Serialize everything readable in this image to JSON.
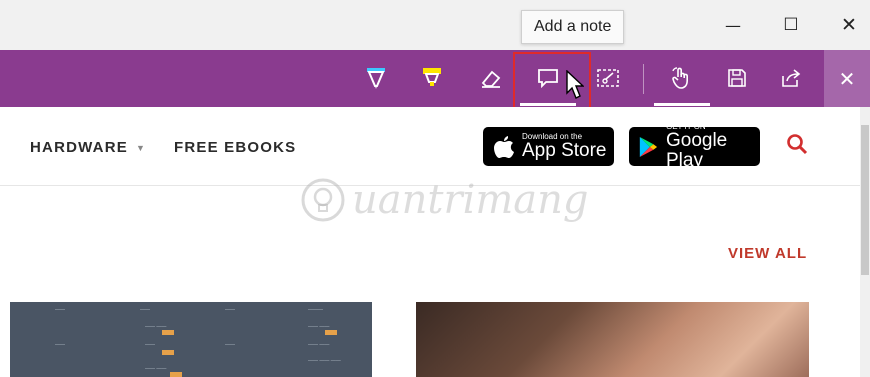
{
  "window": {
    "tooltip": "Add a note",
    "minimize_glyph": "—",
    "maximize_glyph": "☐",
    "close_glyph": "✕"
  },
  "ink_toolbar": {
    "tools": [
      {
        "name": "ballpoint-pen",
        "icon": "pen-icon",
        "color": "#3cc8ff"
      },
      {
        "name": "highlighter",
        "icon": "highlighter-icon",
        "color": "#ffe600"
      },
      {
        "name": "eraser",
        "icon": "eraser-icon"
      },
      {
        "name": "add-a-note",
        "icon": "note-icon",
        "active": true
      },
      {
        "name": "clip",
        "icon": "clip-icon"
      },
      {
        "name": "touch-writing",
        "icon": "touch-icon",
        "active": true
      },
      {
        "name": "save-web-note",
        "icon": "save-icon"
      },
      {
        "name": "share-web-note",
        "icon": "share-icon"
      },
      {
        "name": "exit",
        "icon": "close-icon"
      }
    ],
    "exit_glyph": "✕",
    "background": "#8a3b8f"
  },
  "site_nav": {
    "items": [
      {
        "label": "HARDWARE",
        "has_dropdown": true
      },
      {
        "label": "FREE EBOOKS",
        "has_dropdown": false
      }
    ],
    "caret": "▼",
    "app_store": {
      "small": "Download on the",
      "big": "App Store"
    },
    "google_play": {
      "small": "GET IT ON",
      "big": "Google Play"
    },
    "search_icon": "search-icon",
    "accent": "#c0392b"
  },
  "watermark": {
    "text": "uantrimang"
  },
  "section": {
    "view_all": "VIEW ALL"
  }
}
